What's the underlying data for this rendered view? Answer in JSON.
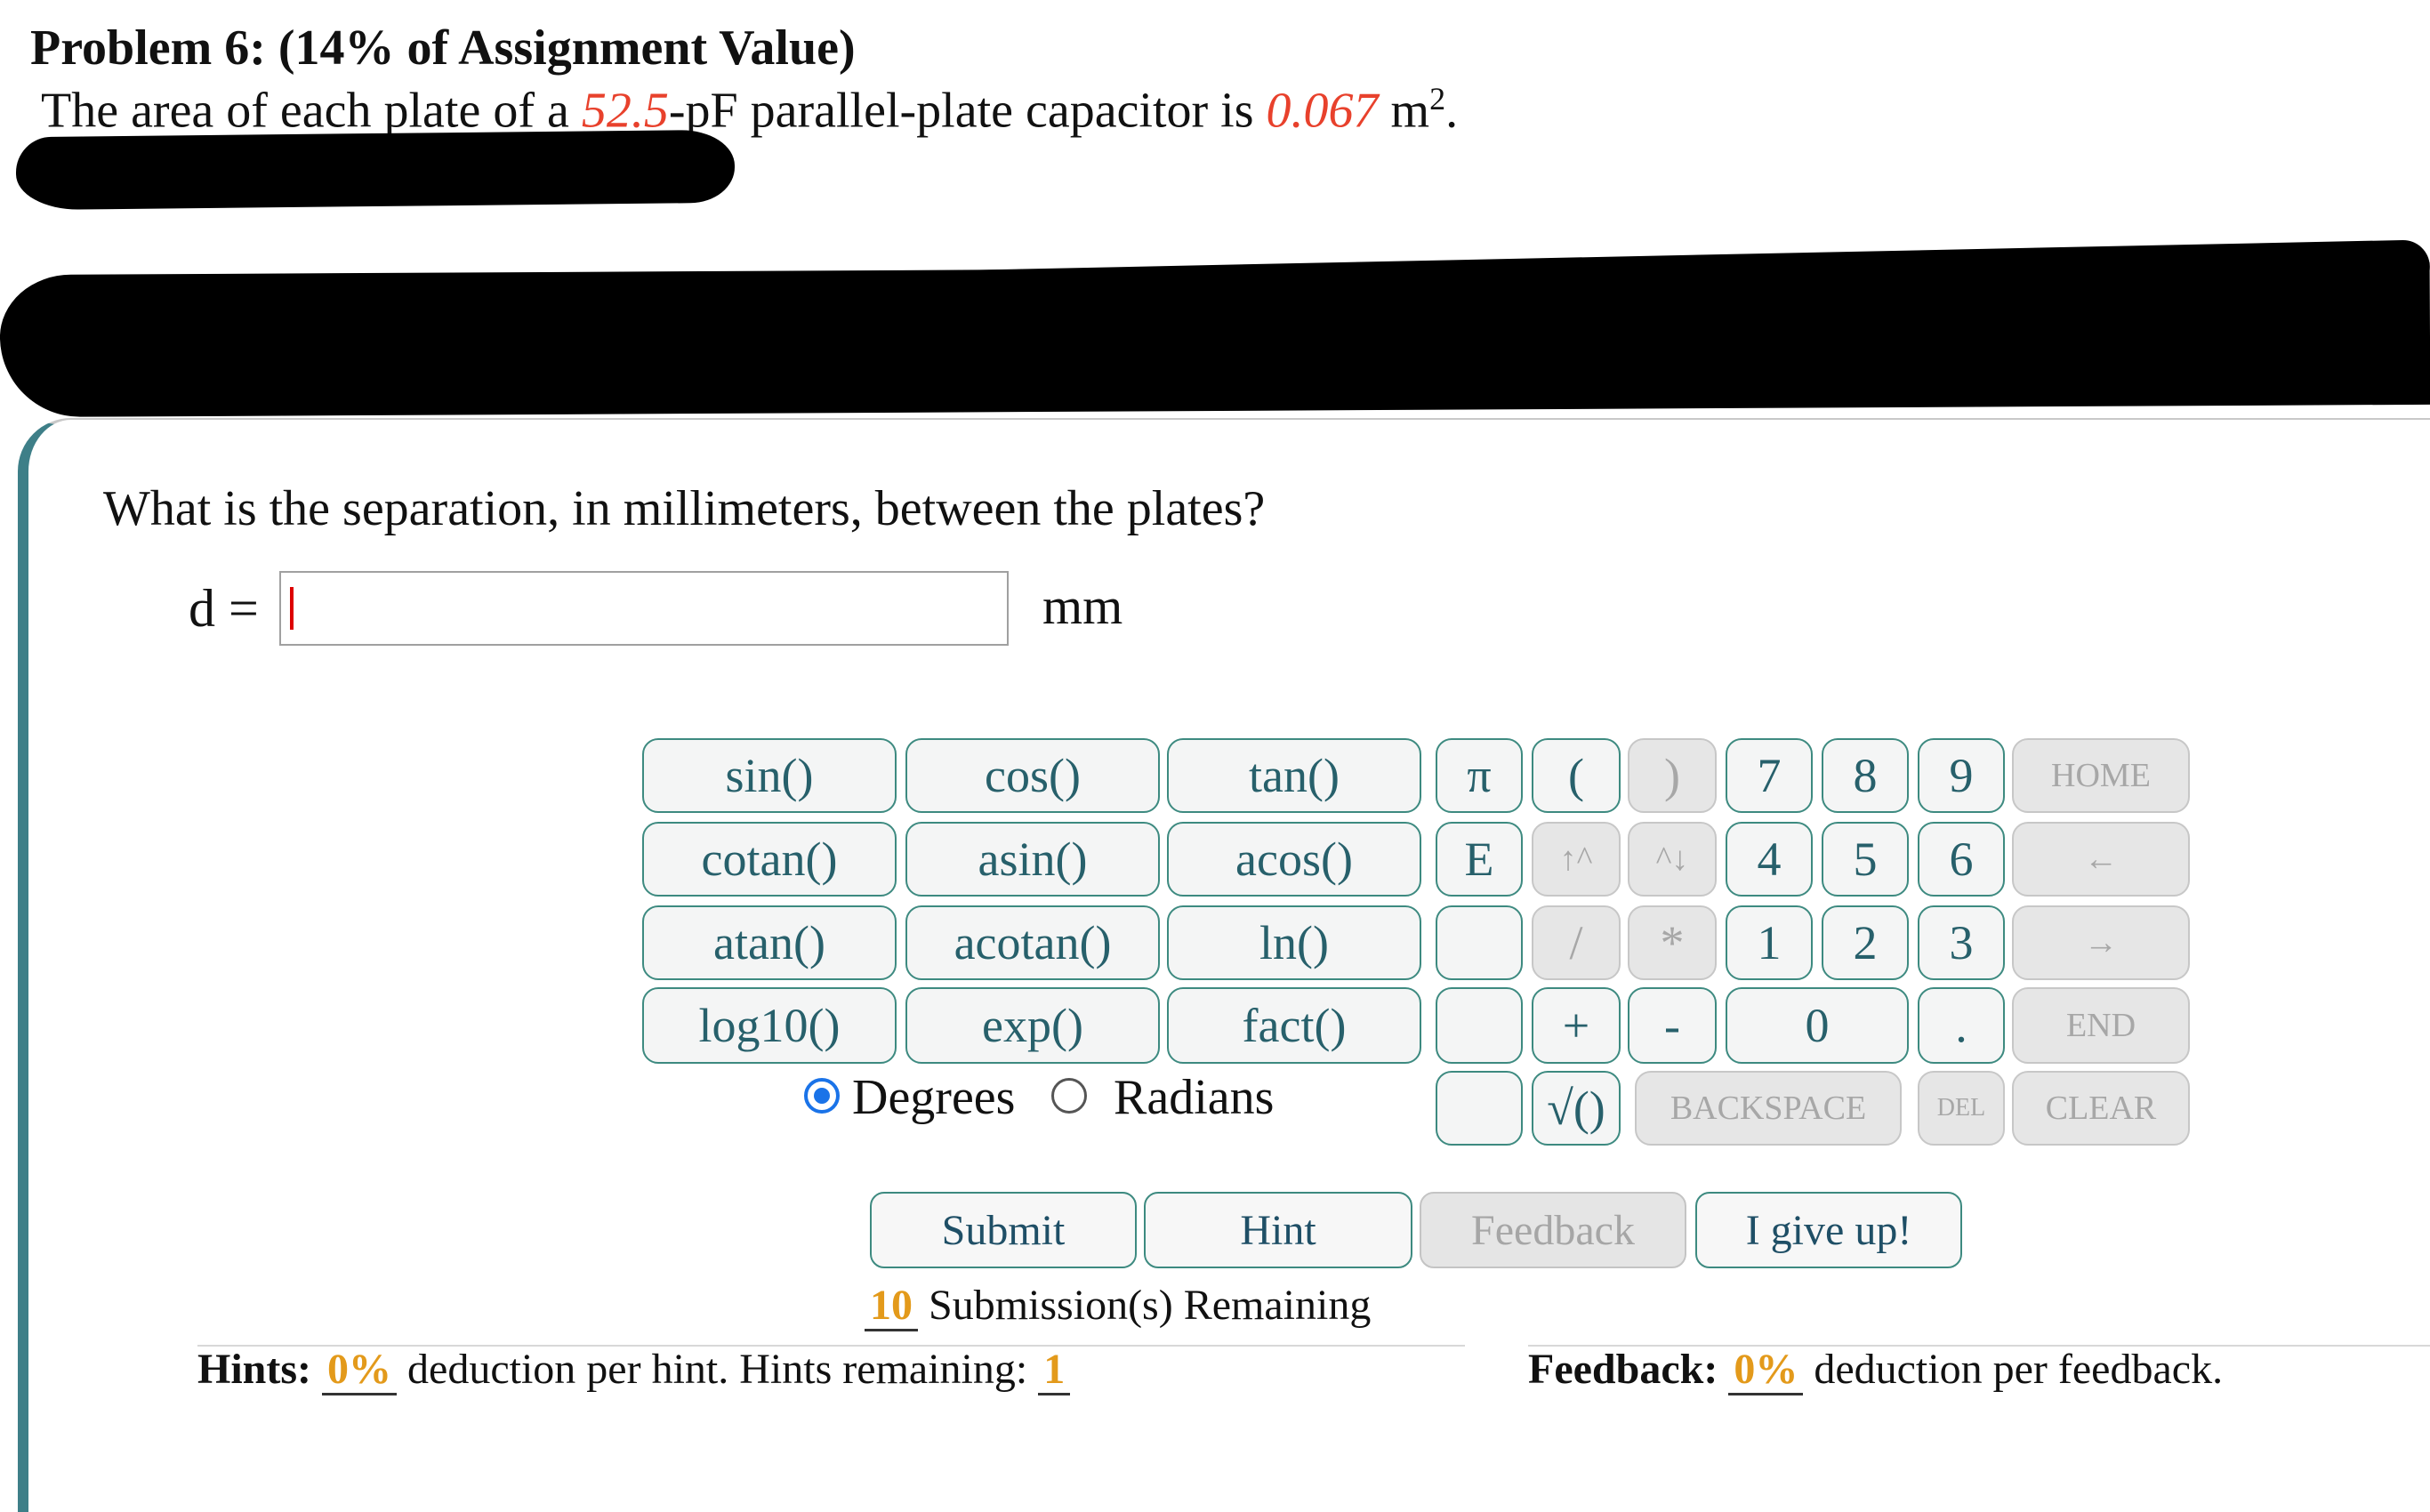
{
  "problem": {
    "title": "Problem 6: (14% of Assignment Value)",
    "statement_prefix": "The area of each plate of a ",
    "capacitance": "52.5",
    "statement_mid": "-pF parallel-plate capacitor is ",
    "area": "0.067",
    "statement_suffix": " m",
    "area_unit_power": "2",
    "statement_end": "."
  },
  "question": {
    "text": "What is the separation, in millimeters, between the plates?",
    "variable_label": "d =",
    "answer_value": "",
    "unit": "mm"
  },
  "keypad": {
    "functions": [
      "sin()",
      "cos()",
      "tan()",
      "cotan()",
      "asin()",
      "acos()",
      "atan()",
      "acotan()",
      "ln()",
      "log10()",
      "exp()",
      "fact()"
    ],
    "symbols": {
      "pi": "π",
      "open_paren": "(",
      "close_paren": ")",
      "E": "E",
      "up_power": "↑^",
      "down_power": "^↓",
      "divide": "/",
      "multiply": "*",
      "plus": "+",
      "minus": "-",
      "sqrt": "√()",
      "decimal": "."
    },
    "digits": [
      "7",
      "8",
      "9",
      "4",
      "5",
      "6",
      "1",
      "2",
      "3",
      "0"
    ],
    "nav": {
      "home": "HOME",
      "left": "←",
      "right": "→",
      "end": "END",
      "backspace": "BACKSPACE",
      "del": "DEL",
      "clear": "CLEAR"
    },
    "angle_modes": {
      "degrees": "Degrees",
      "radians": "Radians",
      "selected": "Degrees"
    }
  },
  "actions": {
    "submit": "Submit",
    "hint": "Hint",
    "feedback": "Feedback",
    "give_up": "I give up!"
  },
  "status": {
    "submissions_remaining": "10",
    "submissions_text": " Submission(s) Remaining",
    "hints_label": "Hints:",
    "hint_deduction": "0%",
    "hints_text": " deduction per hint. Hints remaining: ",
    "hints_remaining": "1",
    "feedback_label": "Feedback:",
    "feedback_deduction": "0%",
    "feedback_text": " deduction per feedback."
  },
  "colors": {
    "accent": "#3d8a80",
    "highlight_value": "#e8412c",
    "status_number": "#e39a1b",
    "radio_selected": "#1a73e8"
  }
}
